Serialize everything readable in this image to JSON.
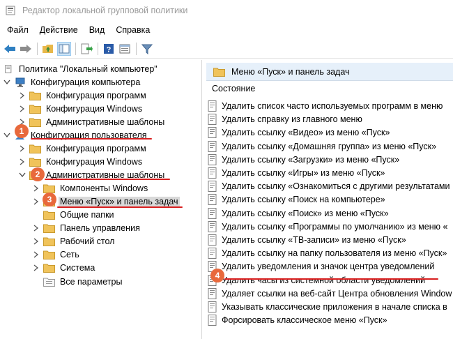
{
  "window": {
    "title": "Редактор локальной групповой политики",
    "icon": "group-policy-app-icon"
  },
  "menu": [
    "Файл",
    "Действие",
    "Вид",
    "Справка"
  ],
  "toolbar": {
    "buttons": [
      "back-arrow-icon",
      "forward-arrow-icon",
      "up-folder-icon",
      "show-hide-tree-icon",
      "export-list-icon",
      "help-icon",
      "properties-icon",
      "filter-icon"
    ]
  },
  "tree": {
    "root": "Политика \"Локальный компьютер\"",
    "computer_config": "Конфигурация компьютера",
    "cc_programs": "Конфигурация программ",
    "cc_windows": "Конфигурация Windows",
    "cc_admin": "Административные шаблоны",
    "user_config": "Конфигурация пользователя",
    "uc_programs": "Конфигурация программ",
    "uc_windows": "Конфигурация Windows",
    "uc_admin": "Административные шаблоны",
    "windows_components": "Компоненты Windows",
    "start_menu": "Меню «Пуск» и панель задач",
    "shared_folders": "Общие папки",
    "control_panel": "Панель управления",
    "desktop": "Рабочий стол",
    "network": "Сеть",
    "system": "Система",
    "all_settings": "Все параметры"
  },
  "right": {
    "header": "Меню «Пуск» и панель задач",
    "column": "Состояние",
    "items": [
      "Удалить список часто используемых программ в меню",
      "Удалить справку из главного меню",
      "Удалить ссылку «Видео» из меню «Пуск»",
      "Удалить ссылку «Домашняя группа» из меню «Пуск»",
      "Удалить ссылку «Загрузки» из меню «Пуск»",
      "Удалить ссылку «Игры» из меню «Пуск»",
      "Удалить ссылку «Ознакомиться с другими результатами",
      "Удалить ссылку «Поиск на компьютере»",
      "Удалить ссылку «Поиск» из меню «Пуск»",
      "Удалить ссылку «Программы по умолчанию» из меню «",
      "Удалить ссылку «ТВ-записи» из меню «Пуск»",
      "Удалить ссылку на папку пользователя из меню «Пуск»",
      "Удалить уведомления и значок центра уведомлений",
      "Удалить часы из системной области уведомлений",
      "Удаляет ссылки на веб-сайт Центра обновления Window",
      "Указывать классические приложения в начале списка в",
      "Форсировать классическое меню «Пуск»"
    ]
  },
  "annotations": {
    "step1": "1",
    "step2": "2",
    "step3": "3",
    "step4": "4"
  },
  "colors": {
    "badge": "#e8693c",
    "underline": "#d81e1e",
    "folder": "#e8b84a",
    "header_bg": "#e6f0fa"
  }
}
